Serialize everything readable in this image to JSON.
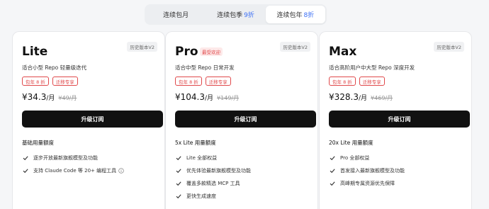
{
  "tabs": [
    {
      "label": "连续包月",
      "discount": "",
      "active": false
    },
    {
      "label": "连续包季",
      "discount": "9折",
      "active": false
    },
    {
      "label": "连续包年",
      "discount": "8折",
      "active": true
    }
  ],
  "colors": {
    "accent": "#3b6ff5",
    "tag_red": "#e0484a",
    "button_bg": "#111111"
  },
  "plans": [
    {
      "name": "Lite",
      "hot_badge": "",
      "history_badge": "历史版本V2",
      "description": "适合小型 Repo 轻量级迭代",
      "tags": [
        "包年 8 折",
        "迁移专享"
      ],
      "price": "¥34.3",
      "period": "/月",
      "original_price": "¥49/月",
      "button": "升级订阅",
      "quota": "基础用量额度",
      "features": [
        "逐步开放最新旗舰模型及功能",
        "支持 Claude Code 等 20+ 编程工具"
      ]
    },
    {
      "name": "Pro",
      "hot_badge": "最受欢迎",
      "history_badge": "历史版本V2",
      "description": "适合中型 Repo 日常开发",
      "tags": [
        "包年 8 折",
        "迁移专享"
      ],
      "price": "¥104.3",
      "period": "/月",
      "original_price": "¥149/月",
      "button": "升级订阅",
      "quota": "5x Lite 用量额度",
      "features": [
        "Lite 全部权益",
        "优先体验最新旗舰模型及功能",
        "覆盖多款精选 MCP 工具",
        "更快生成速度"
      ]
    },
    {
      "name": "Max",
      "hot_badge": "",
      "history_badge": "历史版本V2",
      "description": "适合高阶用户中大型 Repo 深度开发",
      "tags": [
        "包年 8 折",
        "迁移专享"
      ],
      "price": "¥328.3",
      "period": "/月",
      "original_price": "¥469/月",
      "button": "升级订阅",
      "quota": "20x Lite 用量额度",
      "features": [
        "Pro 全部权益",
        "首发接入最新旗舰模型及功能",
        "高峰期专属资源优先保障"
      ]
    }
  ]
}
